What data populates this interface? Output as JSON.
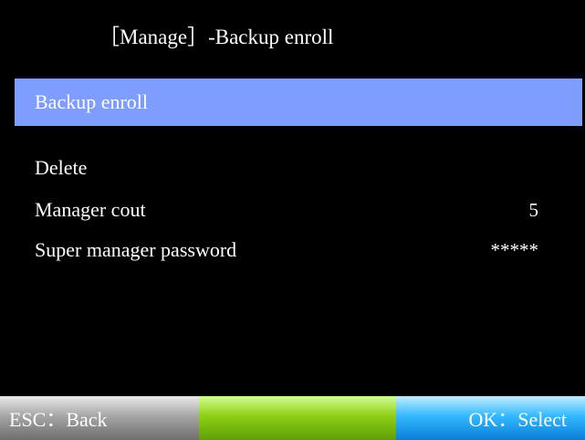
{
  "header": {
    "title": "［Manage］-Backup enroll"
  },
  "menu": {
    "items": [
      {
        "label": "Backup enroll",
        "value": "",
        "selected": true
      },
      {
        "label": "Delete",
        "value": ""
      },
      {
        "label": "Manager cout",
        "value": "5"
      },
      {
        "label": "Super manager password",
        "value": "*****"
      }
    ]
  },
  "softkeys": {
    "left": "ESC：Back",
    "middle": "",
    "right": "OK：Select"
  },
  "colors": {
    "background": "#000000",
    "highlight": "#7f9cff",
    "text": "#ffffff",
    "left_key": "#a6a6a6",
    "middle_key": "#8ed016",
    "right_key": "#33b9ff"
  }
}
